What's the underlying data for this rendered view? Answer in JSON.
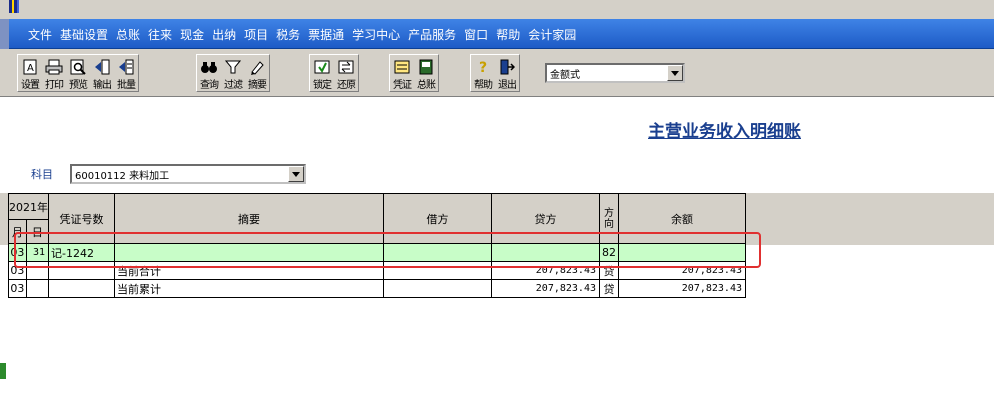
{
  "menu": [
    "文件",
    "基础设置",
    "总账",
    "往来",
    "现金",
    "出纳",
    "项目",
    "税务",
    "票据通",
    "学习中心",
    "产品服务",
    "窗口",
    "帮助",
    "会计家园"
  ],
  "toolbar": {
    "group1": [
      {
        "label": "设置",
        "icon": "settings-icon"
      },
      {
        "label": "打印",
        "icon": "printer-icon"
      },
      {
        "label": "预览",
        "icon": "preview-icon"
      },
      {
        "label": "输出",
        "icon": "export-icon"
      },
      {
        "label": "批量",
        "icon": "batch-icon"
      }
    ],
    "group2": [
      {
        "label": "查询",
        "icon": "binoculars-icon"
      },
      {
        "label": "过滤",
        "icon": "filter-icon"
      },
      {
        "label": "摘要",
        "icon": "summary-icon"
      }
    ],
    "group3": [
      {
        "label": "锁定",
        "icon": "lock-icon"
      },
      {
        "label": "还原",
        "icon": "restore-icon"
      }
    ],
    "group4": [
      {
        "label": "凭证",
        "icon": "voucher-icon"
      },
      {
        "label": "总账",
        "icon": "ledger-icon"
      }
    ],
    "group5": [
      {
        "label": "帮助",
        "icon": "help-icon"
      },
      {
        "label": "退出",
        "icon": "exit-icon"
      }
    ],
    "format_value": "金额式"
  },
  "report": {
    "title": "主营业务收入明细账",
    "subject_label": "科目",
    "subject_value": "60010112 来料加工"
  },
  "ledger": {
    "year": "2021年",
    "headers": {
      "month": "月",
      "day": "日",
      "voucher": "凭证号数",
      "summary": "摘要",
      "debit": "借方",
      "credit": "贷方",
      "direction": "方向",
      "balance": "余额"
    },
    "rows": [
      {
        "month": "03",
        "day": "31",
        "voucher": "记-1242",
        "summary": "",
        "debit": "",
        "credit": "",
        "direction": "82",
        "balance": ""
      },
      {
        "month": "03",
        "day": "",
        "voucher": "",
        "summary": "当前合计",
        "debit": "",
        "credit": "207,823.43",
        "direction": "贷",
        "balance": "207,823.43"
      },
      {
        "month": "03",
        "day": "",
        "voucher": "",
        "summary": "当前累计",
        "debit": "",
        "credit": "207,823.43",
        "direction": "贷",
        "balance": "207,823.43"
      }
    ]
  },
  "colors": {
    "menubar": "#1d5bc6",
    "title": "#1a3f8f",
    "selected_row": "#c8fdc8",
    "highlight_box": "#e03030"
  }
}
